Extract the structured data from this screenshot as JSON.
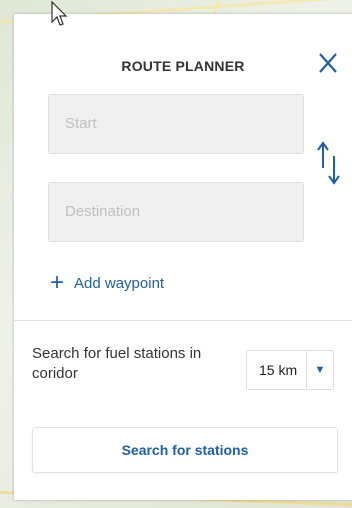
{
  "panel": {
    "title": "ROUTE PLANNER",
    "close_icon": "close-icon",
    "start_placeholder": "Start",
    "destination_placeholder": "Destination",
    "swap_icon": "swap-vertical-icon",
    "add_waypoint": {
      "icon": "plus-icon",
      "label": "Add waypoint"
    },
    "fuel": {
      "label": "Search for fuel stations in coridor",
      "distance_value": "15 km",
      "caret_icon": "caret-down-icon"
    },
    "search_button_label": "Search for stations"
  },
  "colors": {
    "accent": "#1f5fa8",
    "field_bg": "#f0f0f0",
    "placeholder": "#bfbfbf",
    "text": "#333333"
  }
}
